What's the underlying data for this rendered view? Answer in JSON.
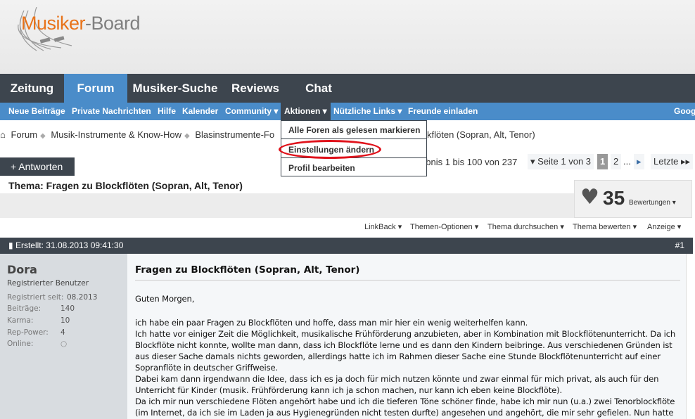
{
  "logo": {
    "part1": "Musiker",
    "part2": "-Board"
  },
  "nav": {
    "tabs": [
      {
        "label": "Zeitung"
      },
      {
        "label": "Forum",
        "active": true
      },
      {
        "label": "Musiker-Suche"
      },
      {
        "label": "Reviews"
      },
      {
        "label": "Chat"
      }
    ]
  },
  "subnav": {
    "items": [
      "Neue Beiträge",
      "Private Nachrichten",
      "Hilfe",
      "Kalender",
      "Community ▾",
      "Aktionen ▾",
      "Nützliche Links ▾",
      "Freunde einladen",
      "Goog"
    ]
  },
  "dropdown": {
    "items": [
      "Alle Foren als gelesen markieren",
      "Einstellungen ändern",
      "Profil bearbeiten"
    ],
    "highlight_color": "#e0121b"
  },
  "breadcrumb": [
    "Forum",
    "Musik-Instrumente & Know-How",
    "Blasinstrumente-Fo",
    "kflöten (Sopran, Alt, Tenor)"
  ],
  "reply_button": "+ Antworten",
  "results": "ebnis 1 bis 100 von 237",
  "pagination": {
    "page_of": "▾ Seite 1 von 3",
    "current": "1",
    "next": "2",
    "ellipsis": "...",
    "next_arrow": "▸",
    "last": "Letzte ▸▸"
  },
  "thread_title": "Thema: Fragen zu Blockflöten (Sopran, Alt, Tenor)",
  "rating": {
    "count": "35",
    "label": "Bewertungen ▾"
  },
  "toolbar": [
    "LinkBack ▾",
    "Themen-Optionen ▾",
    "Thema durchsuchen ▾",
    "Thema bewerten ▾",
    "Anzeige ▾"
  ],
  "post": {
    "created": "Erstellt: 31.08.2013 09:41:30",
    "number": "#1",
    "title": "Fragen zu Blockflöten (Sopran, Alt, Tenor)",
    "lines": [
      "Guten Morgen,",
      "",
      "ich habe ein paar Fragen zu Blockflöten und hoffe, dass man mir hier ein wenig weiterhelfen kann.",
      "Ich hatte vor einiger Zeit die Möglichkeit, musikalische Frühförderung anzubieten, aber in Kombination mit Blockflötenunterricht. Da ich",
      "Blockflöte nicht konnte, wollte man dann, dass ich Blockflöte lerne und es dann den Kindern beibringe. Aus verschiedenen Gründen ist",
      "aus dieser Sache damals nichts geworden, allerdings hatte ich im Rahmen dieser Sache eine Stunde Blockflötenunterricht auf einer",
      "Sopranflöte in deutscher Griffweise.",
      "Dabei kam dann irgendwann die Idee, dass ich es ja doch für mich nutzen könnte und zwar einmal für mich privat, als auch für den",
      "Unterricht für Kinder (musik. Frühförderung kann ich ja schon machen, nur kann ich eben keine Blockflöte).",
      "Da ich mir nun verschiedene Flöten angehört habe und ich die tieferen Töne schöner finde, habe ich mir nun (u.a.) zwei Tenorblockflöte",
      "(im Internet, da ich sie im Laden ja aus Hygienegründen nicht testen durfte) angesehen und angehört, die mir sehr gefielen. Nun hatte"
    ]
  },
  "user": {
    "name": "Dora",
    "role": "Registrierter Benutzer",
    "stats": [
      {
        "label": "Registriert seit:",
        "value": "08.2013"
      },
      {
        "label": "Beiträge:",
        "value": "140"
      },
      {
        "label": "Karma:",
        "value": "10"
      },
      {
        "label": "Rep-Power:",
        "value": "4"
      },
      {
        "label": "Online:",
        "value": "○"
      }
    ]
  }
}
